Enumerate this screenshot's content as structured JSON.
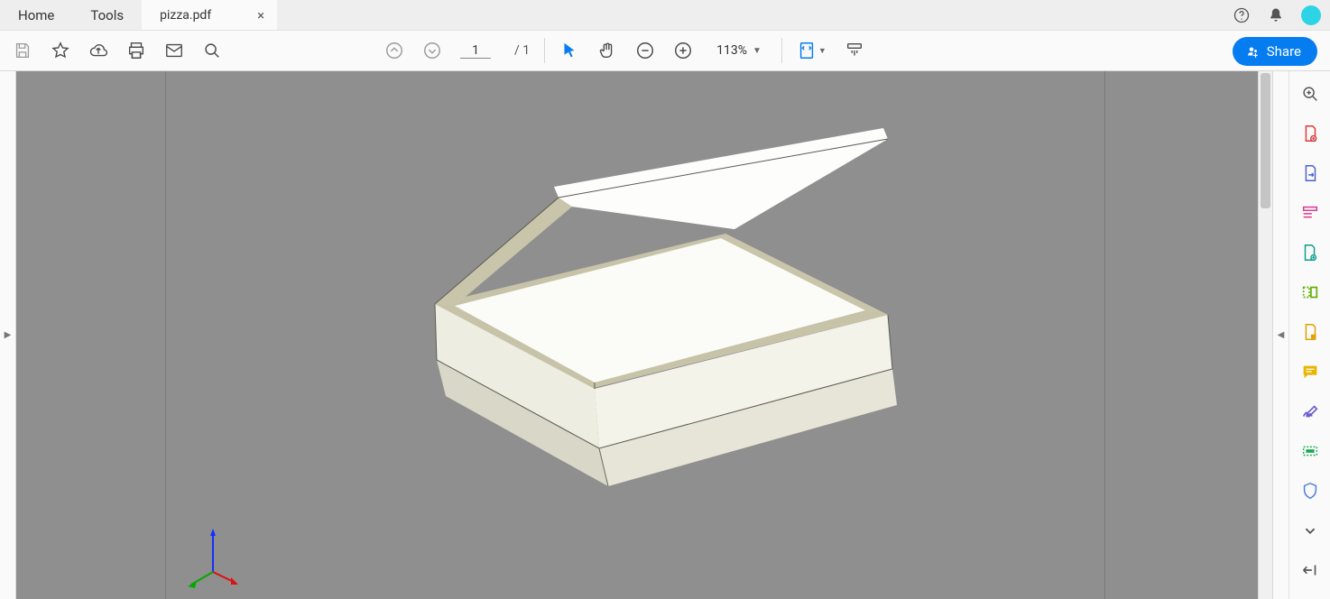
{
  "tabs": {
    "home": "Home",
    "tools": "Tools",
    "document": "pizza.pdf"
  },
  "toolbar": {
    "page_current": "1",
    "page_total": "/ 1",
    "zoom": "113%",
    "share": "Share"
  }
}
